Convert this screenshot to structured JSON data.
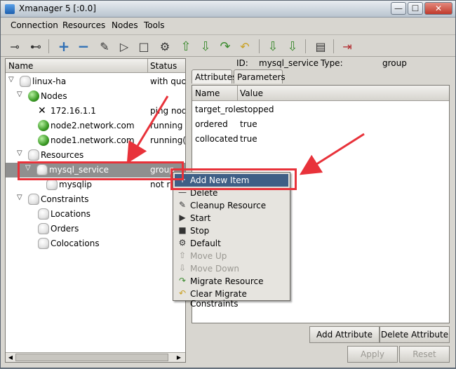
{
  "window": {
    "title": "Xmanager 5 [:0.0]",
    "minimize": "—",
    "maximize": "☐",
    "close": "✕"
  },
  "menu": [
    "Connection",
    "Resources",
    "Nodes",
    "Tools"
  ],
  "tree": {
    "headers": {
      "name": "Name",
      "status": "Status"
    },
    "rows": [
      {
        "label": "linux-ha",
        "status": "with quor"
      },
      {
        "label": "Nodes",
        "status": ""
      },
      {
        "label": "172.16.1.1",
        "status": "ping node"
      },
      {
        "label": "node2.network.com",
        "status": "running"
      },
      {
        "label": "node1.network.com",
        "status": "running(d"
      },
      {
        "label": "Resources",
        "status": ""
      },
      {
        "label": "mysql_service",
        "status": "group"
      },
      {
        "label": "mysqlip",
        "status": "not ru"
      },
      {
        "label": "Constraints",
        "status": ""
      },
      {
        "label": "Locations",
        "status": ""
      },
      {
        "label": "Orders",
        "status": ""
      },
      {
        "label": "Colocations",
        "status": ""
      }
    ]
  },
  "detail": {
    "id_label": "ID:",
    "id_value": "mysql_service",
    "type_label": "Type:",
    "type_value": "group",
    "tabs": [
      "Attributes",
      "Parameters"
    ],
    "columns": {
      "name": "Name",
      "value": "Value"
    },
    "attributes": [
      {
        "name": "target_role",
        "value": "stopped"
      },
      {
        "name": "ordered",
        "value": "true"
      },
      {
        "name": "collocated",
        "value": "true"
      }
    ],
    "add_attribute": "Add Attribute",
    "delete_attribute": "Delete Attribute",
    "apply": "Apply",
    "reset": "Reset"
  },
  "context_menu": [
    {
      "label": "Add New Item",
      "icon": "+",
      "state": "highlighted"
    },
    {
      "label": "Delete",
      "icon": "—",
      "state": "normal"
    },
    {
      "label": "Cleanup Resource",
      "icon": "✎",
      "state": "normal"
    },
    {
      "label": "Start",
      "icon": "▶",
      "state": "normal"
    },
    {
      "label": "Stop",
      "icon": "■",
      "state": "normal"
    },
    {
      "label": "Default",
      "icon": "⚙",
      "state": "normal"
    },
    {
      "label": "Move Up",
      "icon": "⇧",
      "state": "disabled"
    },
    {
      "label": "Move Down",
      "icon": "⇩",
      "state": "disabled"
    },
    {
      "label": "Migrate Resource",
      "icon": "↷",
      "state": "normal"
    },
    {
      "label": "Clear Migrate Constraints",
      "icon": "↶",
      "state": "normal"
    }
  ],
  "colors": {
    "annotation": "#e8323a",
    "menu_highlight": "#3f5f86",
    "selection": "#8f8f8f"
  }
}
